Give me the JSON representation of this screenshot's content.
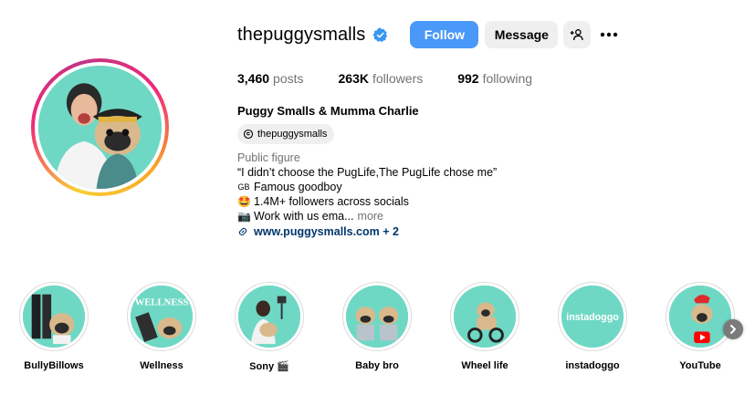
{
  "profile": {
    "username": "thepuggysmalls",
    "verified": true,
    "avatar_icon": "profile-photo-woman-and-pug",
    "buttons": {
      "follow": "Follow",
      "message": "Message",
      "suggest_icon": "add-person-icon",
      "more_icon": "more-options-icon"
    },
    "stats": {
      "posts_count": "3,460",
      "posts_label": "posts",
      "followers_count": "263K",
      "followers_label": "followers",
      "following_count": "992",
      "following_label": "following"
    },
    "full_name": "Puggy Smalls & Mumma Charlie",
    "threads_handle": "thepuggysmalls",
    "bio": {
      "category": "Public figure",
      "line1": "“I didn’t choose the PugLife,The PugLife chose me”",
      "line2_emoji": "GB",
      "line2": "Famous goodboy",
      "line3_emoji": "🤩",
      "line3": "1.4M+ followers across socials",
      "line4_emoji": "📷",
      "line4": "Work with us ema...",
      "more": "more",
      "link": "www.puggysmalls.com + 2"
    }
  },
  "highlights": [
    {
      "label": "BullyBillows"
    },
    {
      "label": "Wellness"
    },
    {
      "label": "Sony 🎬"
    },
    {
      "label": "Baby bro"
    },
    {
      "label": "Wheel life"
    },
    {
      "label": "instadoggo"
    },
    {
      "label": "YouTube"
    }
  ],
  "highlight_texts": {
    "wellness_overlay": "WELLNESS",
    "instadoggo_overlay": "instadoggo"
  },
  "colors": {
    "accent_blue": "#4a98f7",
    "verified_blue": "#3897f0",
    "link_blue": "#00376b",
    "highlight_bg": "#6fd8c4"
  }
}
